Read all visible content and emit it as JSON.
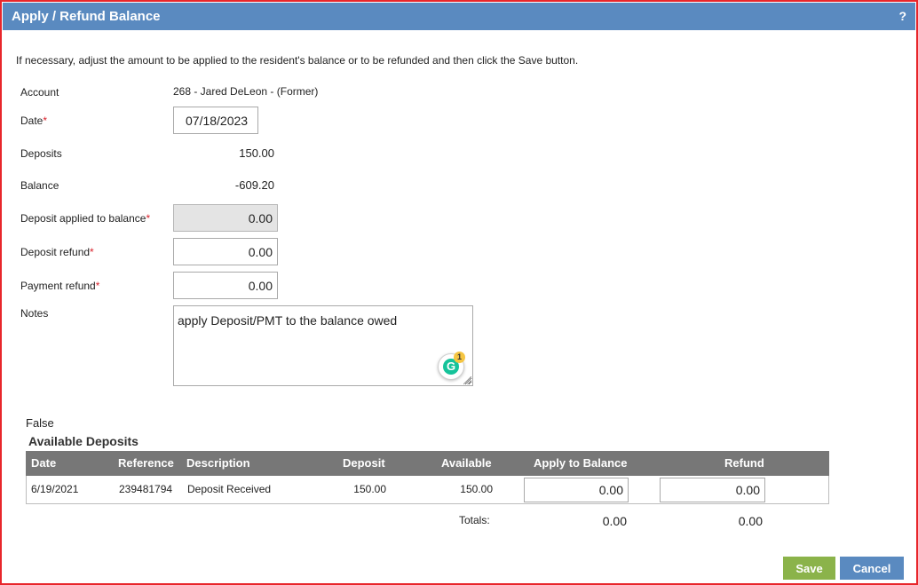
{
  "dialog": {
    "title": "Apply / Refund Balance",
    "help_label": "?",
    "instructions": "If necessary, adjust the amount to be applied to the resident's balance or to be refunded and then click the Save button."
  },
  "form": {
    "account": {
      "label": "Account",
      "value": "268 - Jared DeLeon - (Former)"
    },
    "date": {
      "label": "Date",
      "required": "*",
      "value": "07/18/2023"
    },
    "deposits": {
      "label": "Deposits",
      "value": "150.00"
    },
    "balance": {
      "label": "Balance",
      "value": "-609.20"
    },
    "deposit_applied": {
      "label": "Deposit applied to balance",
      "required": "*",
      "value": "0.00"
    },
    "deposit_refund": {
      "label": "Deposit refund",
      "required": "*",
      "value": "0.00"
    },
    "payment_refund": {
      "label": "Payment refund",
      "required": "*",
      "value": "0.00"
    },
    "notes": {
      "label": "Notes",
      "value": "apply Deposit/PMT to the balance owed"
    }
  },
  "grammarly": {
    "letter": "G",
    "badge_count": "1"
  },
  "status_text": "False",
  "available_deposits": {
    "title": "Available Deposits",
    "columns": [
      "Date",
      "Reference",
      "Description",
      "Deposit",
      "Available",
      "Apply to Balance",
      "Refund"
    ],
    "rows": [
      {
        "date": "6/19/2021",
        "reference": "239481794",
        "description": "Deposit Received",
        "deposit": "150.00",
        "available": "150.00",
        "apply_to_balance": "0.00",
        "refund": "0.00"
      }
    ],
    "totals_label": "Totals:",
    "total_apply": "0.00",
    "total_refund": "0.00"
  },
  "buttons": {
    "save": "Save",
    "cancel": "Cancel"
  },
  "colors": {
    "title_bar": "#5a8ac0",
    "border": "#e8262b",
    "save_button": "#8bb34a",
    "cancel_button": "#5a8ac0",
    "table_header": "#777777",
    "required": "#d9232d"
  }
}
